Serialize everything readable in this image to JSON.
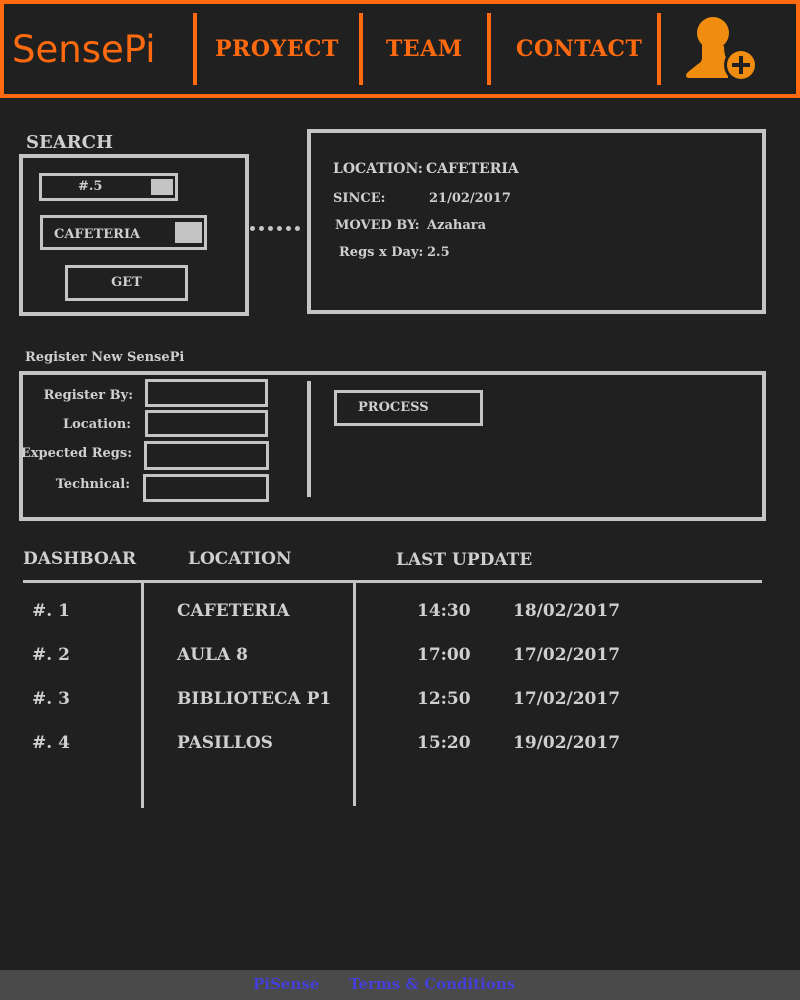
{
  "header": {
    "logo": "SensePi",
    "nav": [
      "PROYECT",
      "TEAM",
      "CONTACT"
    ],
    "user_icon": "user-add-icon",
    "accent_color": "#ff6a10"
  },
  "search": {
    "title": "SEARCH",
    "id_value": "#.5",
    "location_value": "CAFETERIA",
    "get_label": "GET"
  },
  "details": {
    "location_label": "LOCATION:",
    "location_value": "CAFETERIA",
    "since_label": "SINCE:",
    "since_value": "21/02/2017",
    "moved_label": "MOVED BY:",
    "moved_value": "Azahara",
    "regs_label": "Regs x Day:",
    "regs_value": "2.5"
  },
  "register": {
    "title": "Register New SensePi",
    "labels": [
      "Register By:",
      "Location:",
      "Expected Regs:",
      "Technical:"
    ],
    "process_label": "PROCESS"
  },
  "dashboard": {
    "headers": [
      "DASHBOAR",
      "LOCATION",
      "LAST UPDATE"
    ],
    "rows": [
      {
        "id": "#. 1",
        "location": "CAFETERIA",
        "time": "14:30",
        "date": "18/02/2017"
      },
      {
        "id": "#. 2",
        "location": "AULA 8",
        "time": "17:00",
        "date": "17/02/2017"
      },
      {
        "id": "#. 3",
        "location": "BIBLIOTECA P1",
        "time": "12:50",
        "date": "17/02/2017"
      },
      {
        "id": "#. 4",
        "location": "PASILLOS",
        "time": "15:20",
        "date": "19/02/2017"
      }
    ]
  },
  "footer": {
    "links": [
      "PiSense",
      "Terms & Conditions"
    ]
  }
}
